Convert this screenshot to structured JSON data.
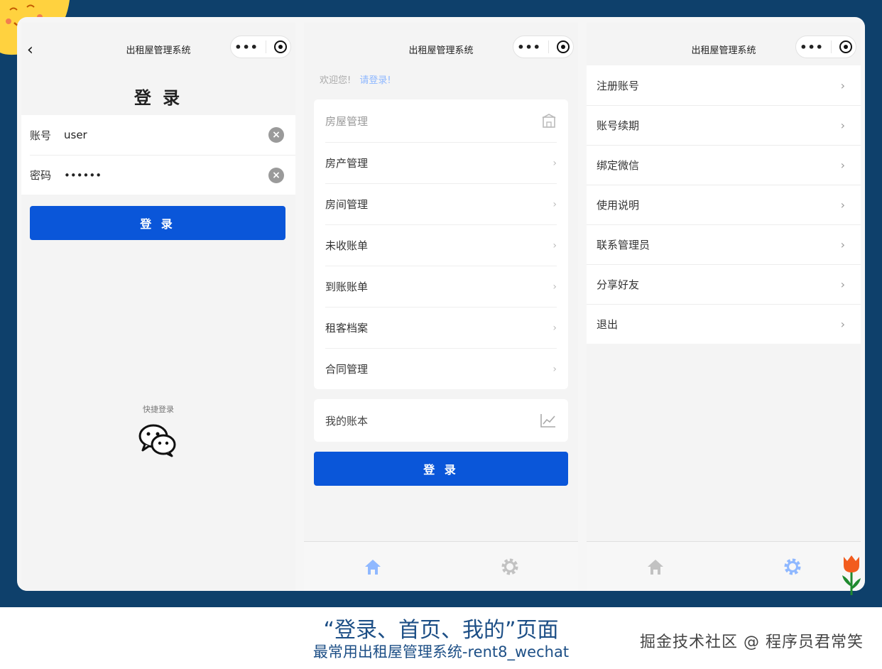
{
  "app": {
    "title": "出租屋管理系统"
  },
  "login": {
    "heading": "登 录",
    "username_label": "账号",
    "username_value": "user",
    "password_label": "密码",
    "password_value": "••••••",
    "login_button": "登 录",
    "quick_login_label": "快捷登录"
  },
  "home": {
    "welcome_text": "欢迎您!",
    "login_link": "请登录!",
    "house_section_title": "房屋管理",
    "menu_items": [
      {
        "label": "房产管理"
      },
      {
        "label": "房间管理"
      },
      {
        "label": "未收账单"
      },
      {
        "label": "到账账单"
      },
      {
        "label": "租客档案"
      },
      {
        "label": "合同管理"
      }
    ],
    "account_book_label": "我的账本",
    "login_button": "登 录"
  },
  "mine": {
    "items": [
      {
        "label": "注册账号"
      },
      {
        "label": "账号续期"
      },
      {
        "label": "绑定微信"
      },
      {
        "label": "使用说明"
      },
      {
        "label": "联系管理员"
      },
      {
        "label": "分享好友"
      },
      {
        "label": "退出"
      }
    ]
  },
  "tabbar": {
    "active_color": "#8fb8ff",
    "inactive_color": "#c2c2c2"
  },
  "caption": {
    "main": "“登录、首页、我的”页面",
    "sub": "最常用出租屋管理系统-rent8_wechat"
  },
  "watermark": "掘金技术社区 @ 程序员君常笑",
  "colors": {
    "primary": "#0a56d9",
    "band": "#0e406b",
    "caption": "#1d4f86"
  }
}
